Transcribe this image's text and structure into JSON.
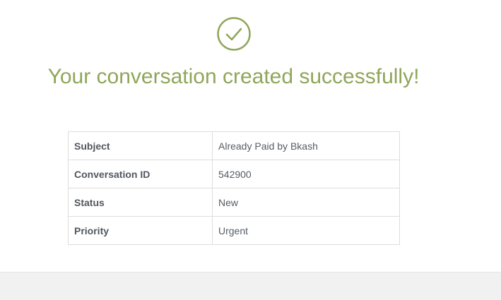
{
  "status_icon": "check-circle-icon",
  "page_title": "Your conversation created successfully!",
  "details": {
    "rows": [
      {
        "label": "Subject",
        "value": "Already Paid by Bkash"
      },
      {
        "label": "Conversation ID",
        "value": "542900"
      },
      {
        "label": "Status",
        "value": "New"
      },
      {
        "label": "Priority",
        "value": "Urgent"
      }
    ]
  },
  "colors": {
    "accent": "#8fa65a",
    "border": "#dddddd",
    "footer_bg": "#f1f1f1"
  }
}
